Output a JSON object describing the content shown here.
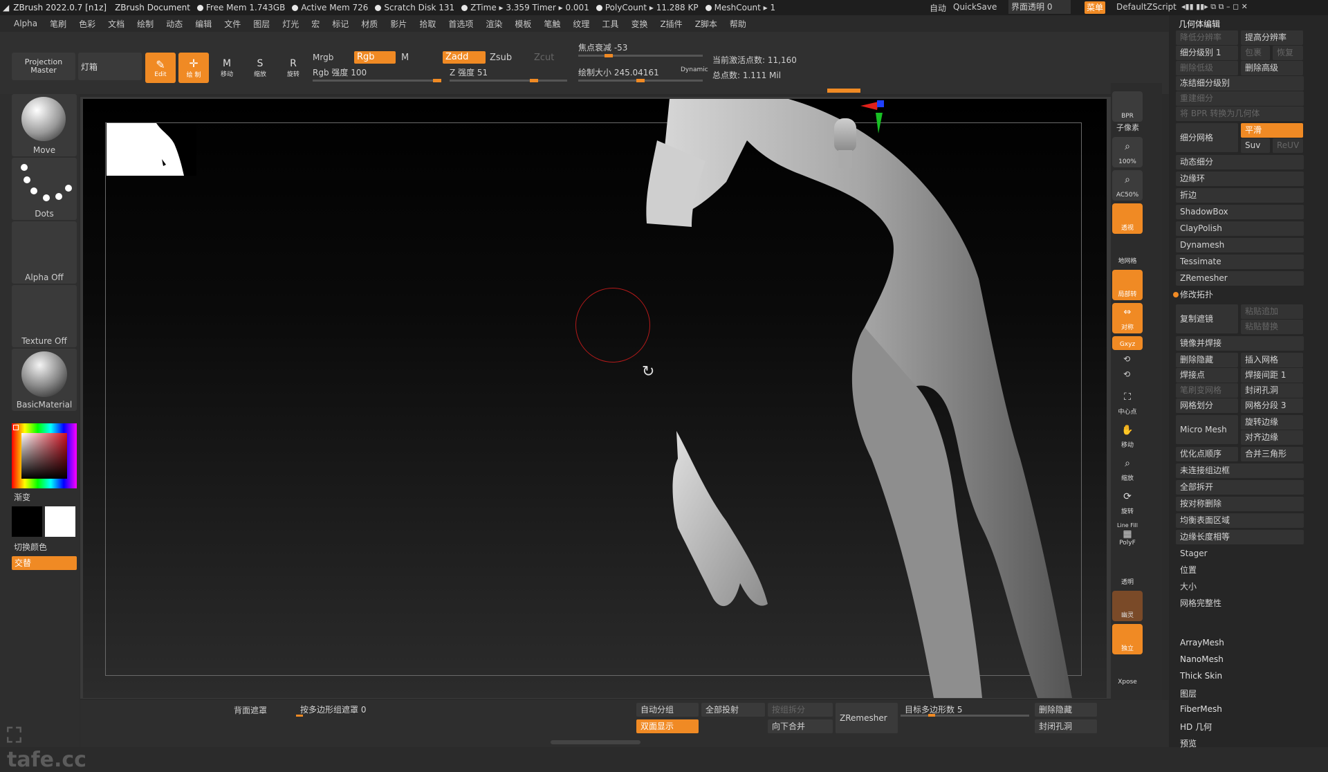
{
  "titlebar": {
    "app": "ZBrush 2022.0.7 [n1z]",
    "doc": "ZBrush Document",
    "free_mem": "Free Mem 1.743GB",
    "active_mem": "Active Mem 726",
    "scratch": "Scratch Disk 131",
    "ztime": "ZTime ▸ 3.359 Timer ▸ 0.001",
    "polycount": "PolyCount ▸ 11.288 KP",
    "meshcount": "MeshCount ▸ 1",
    "auto": "自动",
    "quicksave": "QuickSave",
    "ui_opacity": "界面透明 0",
    "menu": "菜单",
    "zscript": "DefaultZScript"
  },
  "menubar": [
    "Alpha",
    "笔刷",
    "色彩",
    "文档",
    "绘制",
    "动态",
    "编辑",
    "文件",
    "图层",
    "灯光",
    "宏",
    "标记",
    "材质",
    "影片",
    "拾取",
    "首选项",
    "渲染",
    "模板",
    "笔触",
    "纹理",
    "工具",
    "变换",
    "Z插件",
    "Z脚本",
    "帮助"
  ],
  "toolbar": {
    "projection_master": "Projection Master",
    "lightbox": "灯箱",
    "edit": "Edit",
    "draw": "绘 制",
    "move": "移动",
    "scale": "缩放",
    "rotate": "旋转",
    "mrgb": "Mrgb",
    "rgb": "Rgb",
    "m": "M",
    "rgb_intensity": "Rgb 强度 100",
    "zadd": "Zadd",
    "zsub": "Zsub",
    "zcut": "Zcut",
    "z_intensity": "Z 强度 51",
    "focal_shift": "焦点衰减 -53",
    "draw_size": "绘制大小 245.04161",
    "dynamic": "Dynamic",
    "active_points": "当前激活点数: 11,160",
    "total_points": "总点数: 1.111 Mil"
  },
  "leftshelf": {
    "brush": "Move",
    "stroke": "Dots",
    "alpha": "Alpha Off",
    "texture": "Texture Off",
    "material": "BasicMaterial",
    "gradient": "渐变",
    "switch_color": "切换颜色",
    "alternate": "交替"
  },
  "rightshelf": {
    "bpr": "BPR",
    "subpixel": "子像素",
    "zoom100": "100%",
    "ac50": "AC50%",
    "dynamic": "Dynamic",
    "persp": "透视",
    "floor": "地网格",
    "local": "局部转",
    "sym": "对称",
    "xyz": "Gxyz",
    "frame": "中心点",
    "move": "移动",
    "zoom": "缩放",
    "rotate": "旋转",
    "linefill": "Line Fill",
    "polyf": "PolyF",
    "transp": "透明",
    "ghost": "幽灵",
    "solo": "独立",
    "xpose": "Xpose"
  },
  "rightpanel": {
    "header": "几何体编辑",
    "lower_res": "降低分辨率",
    "higher_res": "提高分辨率",
    "sdiv": "细分级别 1",
    "cage": "包裹",
    "rstr": "恢复",
    "del_lower": "删除低级",
    "del_higher": "删除高级",
    "freeze": "冻结细分级别",
    "reconstruct": "重建细分",
    "bpr_to_geo": "将 BPR 转换为几何体",
    "divide": "细分网格",
    "smooth": "平滑",
    "suv": "Suv",
    "reuv": "ReUV",
    "dynamic_sub": "动态细分",
    "edgeloop": "边缘环",
    "crease": "折边",
    "shadowbox": "ShadowBox",
    "claypolish": "ClayPolish",
    "dynamesh": "Dynamesh",
    "tessimate": "Tessimate",
    "zremesher": "ZRemesher",
    "modify_topo": "修改拓扑",
    "copy": "复制遮镜",
    "paste_append": "粘贴追加",
    "paste_replace": "粘贴替换",
    "mirror_weld": "镜像并焊接",
    "del_hidden": "删除隐藏",
    "insert_mesh": "插入网格",
    "weld_points": "焊接点",
    "weld_dist": "焊接间距 1",
    "mesh_from_brush": "笔刷变网格",
    "close_holes": "封闭孔洞",
    "grid_divide": "网格划分",
    "grid_seg": "网格分段 3",
    "micro_mesh": "Micro Mesh",
    "spin_edge": "旋转边缘",
    "align_edge": "对齐边缘",
    "optimize": "优化点顺序",
    "merge_tris": "合并三角形",
    "unweld_groups": "未连接组边框",
    "unweld_all": "全部拆开",
    "delete_by_sym": "按对称删除",
    "equalize_area": "均衡表面区域",
    "equalize_edge": "边缘长度相等",
    "stager": "Stager",
    "position": "位置",
    "size": "大小",
    "mesh_integrity": "网格完整性",
    "arraymesh": "ArrayMesh",
    "nanomesh": "NanoMesh",
    "thickskin": "Thick Skin",
    "layers": "图层",
    "fibermesh": "FiberMesh",
    "hd_geo": "HD 几何",
    "preview": "预览"
  },
  "bottombar": {
    "backface": "背面遮罩",
    "by_polygroup": "按多边形组遮罩 0",
    "auto_groups": "自动分组",
    "project_all": "全部投射",
    "group_split": "按组拆分",
    "double": "双面显示",
    "merge_down": "向下合并",
    "zremesher": "ZRemesher",
    "target_poly": "目标多边形数 5",
    "del_hidden": "删除隐藏",
    "close_holes": "封闭孔洞"
  },
  "watermark": "tafe.cc",
  "colors": {
    "accent": "#f08a24",
    "panel": "#262626"
  }
}
